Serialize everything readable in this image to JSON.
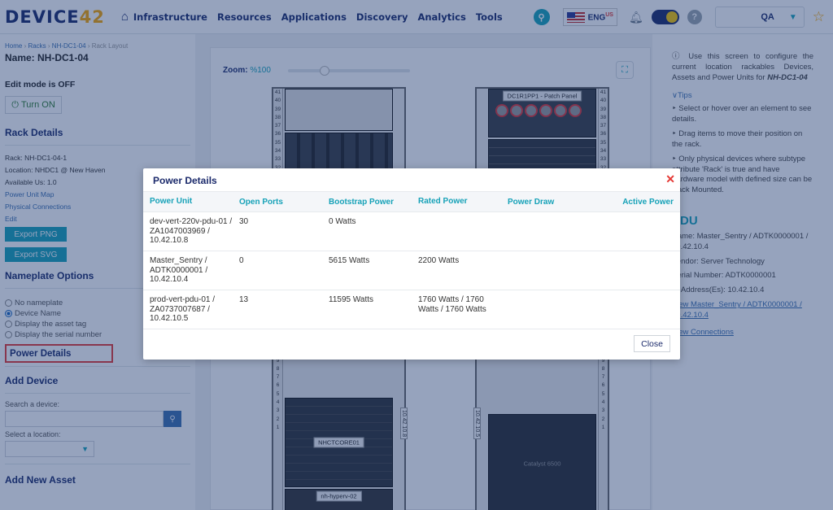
{
  "nav": {
    "logo_text": "DEVICE",
    "logo_num": "42",
    "items": [
      "Infrastructure",
      "Resources",
      "Applications",
      "Discovery",
      "Analytics",
      "Tools"
    ],
    "lang": "ENG",
    "lang_sup": "US",
    "user": "QA"
  },
  "sidebar": {
    "breadcrumb": [
      "Home",
      "Racks",
      "NH-DC1-04",
      "Rack Layout"
    ],
    "name": "Name: NH-DC1-04",
    "edit_mode": "Edit mode is OFF",
    "turn_on": "Turn ON",
    "rack_details_title": "Rack Details",
    "rack": "Rack: NH-DC1-04-1",
    "location": "Location: NHDC1 @ New Haven",
    "available": "Available Us: 1.0",
    "power_unit_map": "Power Unit Map",
    "physical_connections": "Physical Connections",
    "edit": "Edit",
    "export_png": "Export PNG",
    "export_svg": "Export SVG",
    "nameplate_title": "Nameplate Options",
    "nameplate_options": [
      "No nameplate",
      "Device Name",
      "Display the asset tag",
      "Display the serial number"
    ],
    "nameplate_selected": 1,
    "power_details": "Power Details",
    "add_device_title": "Add Device",
    "search_label": "Search a device:",
    "location_label": "Select a location:",
    "add_asset_title": "Add New Asset"
  },
  "main": {
    "zoom_label": "Zoom:",
    "zoom_value": "%100",
    "zoom_level": 0.3,
    "rack1_devices": [
      "NHCTCORE01",
      "nh-hyperv-02"
    ],
    "rack2_devices": [
      "DC1R1PP1 - Patch Panel",
      "Catalyst 6500"
    ],
    "rack1_side_label": "10.42.10.8",
    "rack2_side_label": "10.42.10.5"
  },
  "right_panel": {
    "intro": "Use this screen to configure the current location rackables Devices, Assets and Power Units for",
    "intro_rack": "NH-DC1-04",
    "tips_label": "Tips",
    "tips": [
      "Select or hover over an element to see details.",
      "Drag items to move their position on the rack.",
      "Only physical devices where subtype attribute 'Rack' is true and have hardware model with defined size can be Rack Mounted."
    ],
    "pdu_title": "PDU",
    "pdu_name": "Name: Master_Sentry / ADTK0000001 / 10.42.10.4",
    "pdu_vendor": "Vendor: Server Technology",
    "pdu_serial": "Serial Number: ADTK0000001",
    "pdu_ip": "IP Address(Es): 10.42.10.4",
    "pdu_link": "View Master_Sentry / ADTK0000001 / 10.42.10.4",
    "pdu_connections": "View Connections"
  },
  "modal": {
    "title": "Power Details",
    "columns": [
      "Power Unit",
      "Open Ports",
      "Bootstrap Power",
      "Rated Power",
      "Power Draw",
      "Active Power"
    ],
    "rows": [
      {
        "unit": "dev-vert-220v-pdu-01 / ZA1047003969 / 10.42.10.8",
        "open_ports": "30",
        "bootstrap": "0 Watts",
        "rated": "",
        "draw": "",
        "active": ""
      },
      {
        "unit": "Master_Sentry / ADTK0000001 / 10.42.10.4",
        "open_ports": "0",
        "bootstrap": "5615 Watts",
        "rated": "2200 Watts",
        "draw": "",
        "active": ""
      },
      {
        "unit": "prod-vert-pdu-01 / ZA0737007687 / 10.42.10.5",
        "open_ports": "13",
        "bootstrap": "11595 Watts",
        "rated": "1760 Watts / 1760 Watts / 1760 Watts",
        "draw": "",
        "active": ""
      }
    ],
    "close_label": "Close"
  }
}
